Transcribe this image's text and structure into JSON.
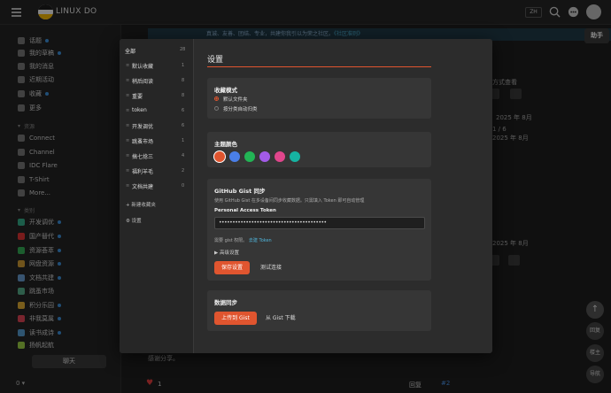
{
  "site": {
    "name": "LINUX DO",
    "lang": "ZH"
  },
  "sidebar": {
    "items": [
      {
        "label": "话题",
        "dot": true
      },
      {
        "label": "我的草稿",
        "dot": true
      },
      {
        "label": "我的消息"
      },
      {
        "label": "近期活动"
      },
      {
        "label": "收藏",
        "dot": true
      },
      {
        "label": "更多"
      }
    ],
    "section_resources": "资源",
    "resources": [
      "Connect",
      "Channel",
      "IDC Flare",
      "T-Shirt",
      "More..."
    ],
    "section_categories": "类别",
    "categories": [
      {
        "label": "开发调优",
        "dot": true
      },
      {
        "label": "国产替代",
        "dot": true
      },
      {
        "label": "资源荟萃",
        "dot": true
      },
      {
        "label": "网盘资源",
        "dot": true
      },
      {
        "label": "文档共建",
        "dot": true
      },
      {
        "label": "跳蚤市场"
      },
      {
        "label": "积分乐园",
        "dot": true
      },
      {
        "label": "非我莫属",
        "dot": true
      },
      {
        "label": "读书成诗",
        "dot": true
      },
      {
        "label": "扬帆起航"
      }
    ],
    "chat_label": "聊天",
    "footer_text": "0 ▾"
  },
  "background": {
    "banner_text": "真诚、友善、团结、专业，共建你我引以为荣之社区。",
    "banner_link": "《社区准则》",
    "helper_label": "助手",
    "side_texts": [
      "方式查看",
      "2025 年 8月",
      "1 / 6",
      "2025 年 8月",
      "2025 年 8月"
    ],
    "thanks_text": "感谢分享。",
    "reply_label": "回复",
    "floor_label": "#2",
    "like_count": "1",
    "round_buttons": [
      "回复",
      "楼主",
      "导航"
    ]
  },
  "modal": {
    "folders_all": {
      "label": "全部",
      "count": "28"
    },
    "folders": [
      {
        "name": "默认收藏",
        "count": "1"
      },
      {
        "name": "稍后阅读",
        "count": "8"
      },
      {
        "name": "重要",
        "count": "8"
      },
      {
        "name": "token",
        "count": "6"
      },
      {
        "name": "开发调优",
        "count": "6"
      },
      {
        "name": "跳蚤市场",
        "count": "1"
      },
      {
        "name": "搞七捻三",
        "count": "4"
      },
      {
        "name": "福利羊毛",
        "count": "2"
      },
      {
        "name": "文档共建",
        "count": "0"
      }
    ],
    "new_folder": "+ 新建收藏夹",
    "settings_link": "⚙ 设置",
    "title": "设置",
    "collect_mode": {
      "title": "收藏模式",
      "options": [
        "默认文件夹",
        "按分类自动归类"
      ],
      "selected": 0
    },
    "theme_color": {
      "title": "主题颜色",
      "swatches": [
        "#e0552f",
        "#4a7fe8",
        "#22b455",
        "#a35be8",
        "#e0468c",
        "#16b3a2"
      ],
      "selected": 0
    },
    "gist": {
      "title": "GitHub Gist 同步",
      "desc": "使用 GitHub Gist 在多设备间同步收藏数据。只需填入 Token 即可自动管理",
      "token_label": "Personal Access Token",
      "token_value": "••••••••••••••••••••••••••••••••••••••••",
      "hint_text": "需要 gist 权限。",
      "hint_link": "去建 Token",
      "advanced": "▶ 高级设置",
      "save_label": "保存设置",
      "test_label": "测试连接"
    },
    "sync": {
      "title": "数据同步",
      "upload_label": "上传到 Gist",
      "download_label": "从 Gist 下载"
    }
  }
}
